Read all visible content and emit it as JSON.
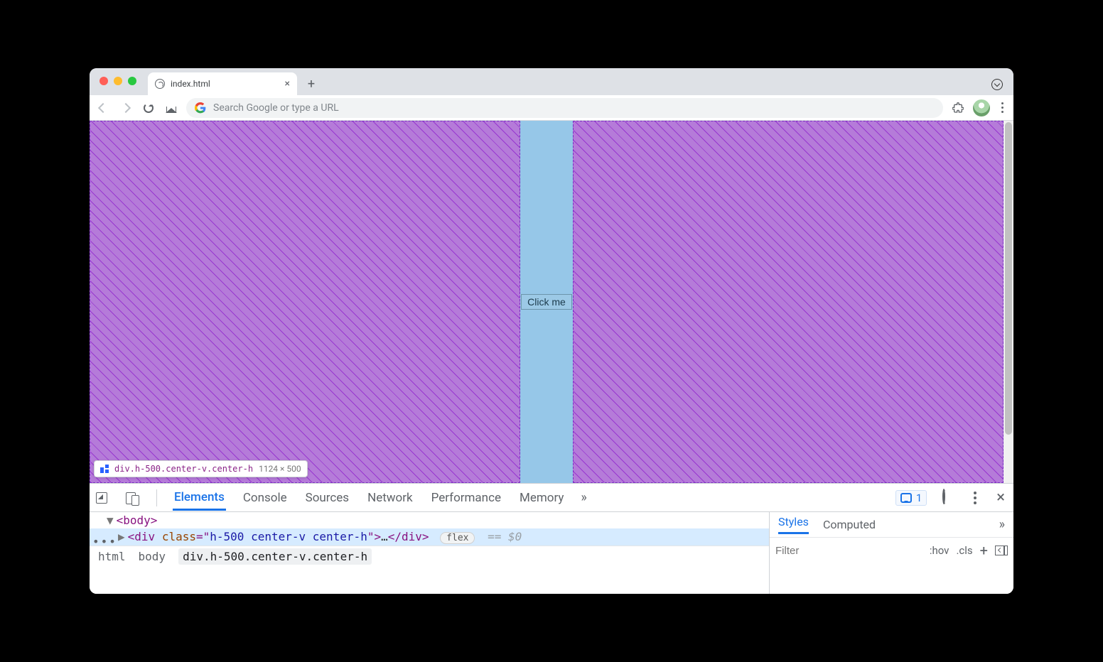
{
  "tab": {
    "title": "index.html"
  },
  "omnibox": {
    "placeholder": "Search Google or type a URL"
  },
  "page": {
    "button_label": "Click me",
    "inspect_tooltip": {
      "selector": "div.h-500.center-v.center-h",
      "dimensions": "1124 × 500"
    }
  },
  "devtools": {
    "tabs": [
      "Elements",
      "Console",
      "Sources",
      "Network",
      "Performance",
      "Memory"
    ],
    "active_tab": "Elements",
    "issues_count": "1",
    "elements": {
      "body_open": "<body>",
      "div_tag": "div",
      "div_attr_name": "class",
      "div_attr_value": "h-500 center-v center-h",
      "div_close": "</div>",
      "flex_badge": "flex",
      "ref": "== $0"
    },
    "breadcrumbs": [
      "html",
      "body",
      "div.h-500.center-v.center-h"
    ],
    "styles": {
      "tabs": [
        "Styles",
        "Computed"
      ],
      "filter_placeholder": "Filter",
      "hov": ":hov",
      "cls": ".cls"
    }
  }
}
